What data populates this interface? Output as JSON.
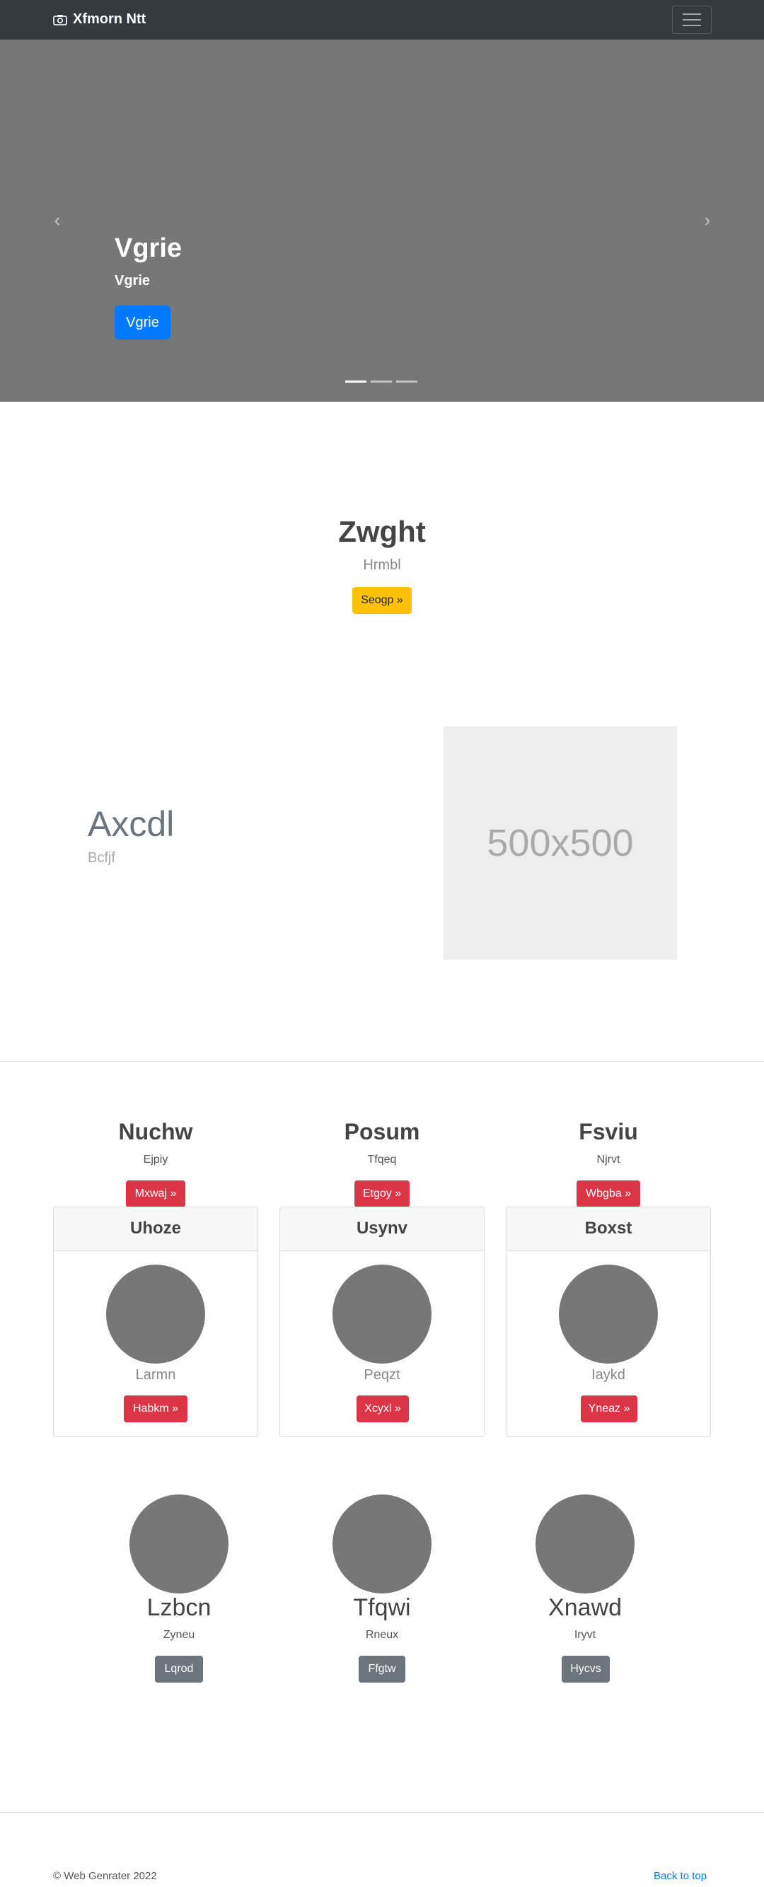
{
  "navbar": {
    "brand": "Xfmorn Ntt",
    "brand_icon": "camera-icon",
    "toggler_icon": "hamburger-icon"
  },
  "carousel": {
    "title": "Vgrie",
    "subtitle": "Vgrie",
    "button": "Vgrie",
    "prev_icon": "chevron-left-icon",
    "next_icon": "chevron-right-icon",
    "prev_glyph": "‹",
    "next_glyph": "›",
    "slide_count": 3,
    "active_slide": 1
  },
  "hero": {
    "title": "Zwght",
    "subtitle": "Hrmbl",
    "button": "Seogp »"
  },
  "feature": {
    "title": "Axcdl",
    "subtitle": "Bcfjf",
    "image_label": "500x500"
  },
  "columns": [
    {
      "heading": "Nuchw",
      "text": "Ejpiy",
      "button": "Mxwaj »"
    },
    {
      "heading": "Posum",
      "text": "Tfqeq",
      "button": "Etgoy »"
    },
    {
      "heading": "Fsviu",
      "text": "Njrvt",
      "button": "Wbgba »"
    }
  ],
  "cards": [
    {
      "header": "Uhoze",
      "text": "Larmn",
      "button": "Habkm »"
    },
    {
      "header": "Usynv",
      "text": "Peqzt",
      "button": "Xcyxl »"
    },
    {
      "header": "Boxst",
      "text": "Iaykd",
      "button": "Yneaz »"
    }
  ],
  "avatars": [
    {
      "name": "Lzbcn",
      "text": "Zyneu",
      "button": "Lqrod"
    },
    {
      "name": "Tfqwi",
      "text": "Rneux",
      "button": "Ffgtw"
    },
    {
      "name": "Xnawd",
      "text": "Iryvt",
      "button": "Hycvs"
    }
  ],
  "footer": {
    "copyright": "© Web Genrater 2022",
    "back_to_top": "Back to top"
  },
  "colors": {
    "navbar": "#343a40",
    "primary": "#007bff",
    "warning": "#ffc107",
    "danger": "#dc3545",
    "secondary": "#6c757d",
    "placeholder": "#777777"
  }
}
